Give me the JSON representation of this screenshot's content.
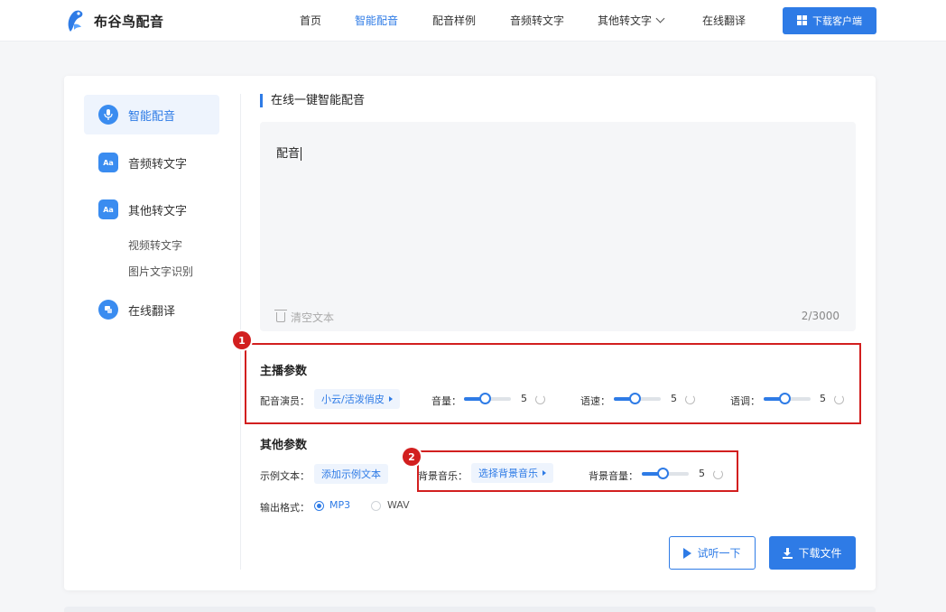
{
  "brand": {
    "name": "布谷鸟配音",
    "color": "#2e7be6"
  },
  "nav": {
    "items": [
      "首页",
      "智能配音",
      "配音样例",
      "音频转文字",
      "其他转文字",
      "在线翻译"
    ],
    "active": "智能配音",
    "download_client": "下载客户端"
  },
  "sidebar": {
    "items": [
      {
        "label": "智能配音",
        "icon": "microphone-icon",
        "active": true
      },
      {
        "label": "音频转文字",
        "icon": "audio-text-icon"
      },
      {
        "label": "其他转文字",
        "icon": "other-text-icon"
      },
      {
        "label": "在线翻译",
        "icon": "translate-icon"
      }
    ],
    "sub_items": [
      "视频转文字",
      "图片文字识别"
    ]
  },
  "main": {
    "section_title": "在线一键智能配音",
    "text_value": "配音",
    "clear_label": "清空文本",
    "char_count": "2/3000",
    "host_params": {
      "title": "主播参数",
      "voice_label": "配音演员：",
      "voice_value": "小云/活泼俏皮",
      "volume_label": "音量：",
      "volume_value": "5",
      "speed_label": "语速：",
      "speed_value": "5",
      "pitch_label": "语调：",
      "pitch_value": "5"
    },
    "other_params": {
      "title": "其他参数",
      "sample_label": "示例文本：",
      "sample_button": "添加示例文本",
      "bgm_label": "背景音乐：",
      "bgm_button": "选择背景音乐",
      "bgm_volume_label": "背景音量：",
      "bgm_volume_value": "5",
      "format_label": "输出格式：",
      "formats": [
        "MP3",
        "WAV"
      ],
      "selected_format": "MP3"
    },
    "listen_button": "试听一下",
    "download_button": "下载文件"
  },
  "annotations": [
    "1",
    "2"
  ],
  "colors": {
    "accent": "#2e7be6",
    "annotation": "#d21f1f"
  }
}
